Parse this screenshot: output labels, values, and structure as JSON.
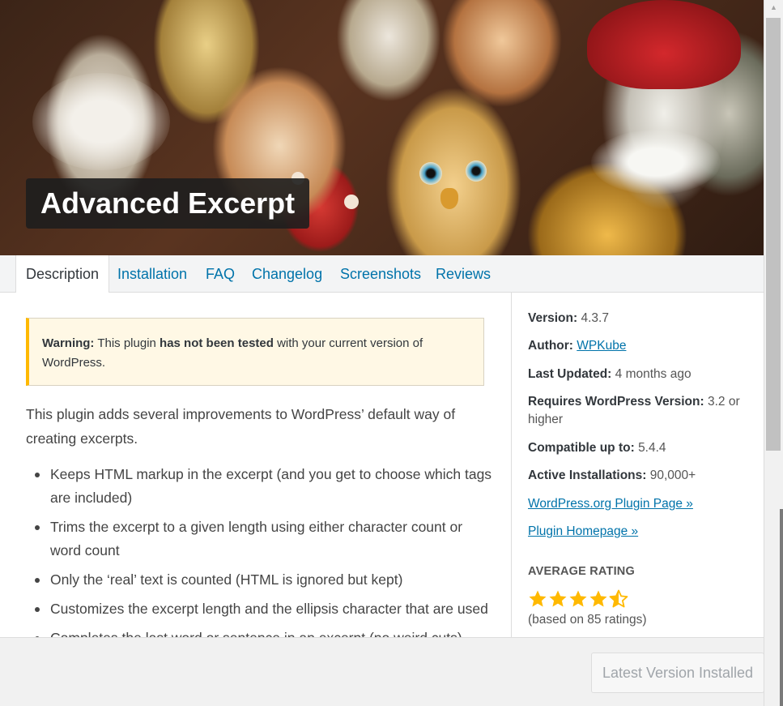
{
  "plugin": {
    "title": "Advanced Excerpt"
  },
  "tabs": [
    {
      "label": "Description",
      "active": true
    },
    {
      "label": "Installation",
      "active": false
    },
    {
      "label": "FAQ",
      "active": false
    },
    {
      "label": "Changelog",
      "active": false
    },
    {
      "label": "Screenshots",
      "active": false
    },
    {
      "label": "Reviews",
      "active": false
    }
  ],
  "notice": {
    "strong_prefix": "Warning:",
    "text_1": " This plugin ",
    "strong_mid": "has not been tested",
    "text_2": " with your current version of WordPress."
  },
  "description": {
    "intro": "This plugin adds several improvements to WordPress’ default way of creating excerpts.",
    "features": [
      "Keeps HTML markup in the excerpt (and you get to choose which tags are included)",
      "Trims the excerpt to a given length using either character count or word count",
      "Only the ‘real’ text is counted (HTML is ignored but kept)",
      "Customizes the excerpt length and the ellipsis character that are used",
      "Completes the last word or sentence in an excerpt (no weird cuts)"
    ]
  },
  "meta": {
    "version_label": "Version:",
    "version_value": "4.3.7",
    "author_label": "Author:",
    "author_value": "WPKube",
    "updated_label": "Last Updated:",
    "updated_value": "4 months ago",
    "requires_label": "Requires WordPress Version:",
    "requires_value": "3.2 or higher",
    "compatible_label": "Compatible up to:",
    "compatible_value": "5.4.4",
    "installs_label": "Active Installations:",
    "installs_value": "90,000+",
    "plugin_page_link": "WordPress.org Plugin Page »",
    "homepage_link": "Plugin Homepage »"
  },
  "rating": {
    "heading": "AVERAGE RATING",
    "stars": 4.5,
    "max_stars": 5,
    "count_text": "(based on 85 ratings)",
    "star_color": "#ffb900"
  },
  "footer": {
    "button_label": "Latest Version Installed"
  },
  "colors": {
    "link": "#0073aa",
    "notice_border": "#ffb900",
    "notice_bg": "#fff8e5"
  }
}
